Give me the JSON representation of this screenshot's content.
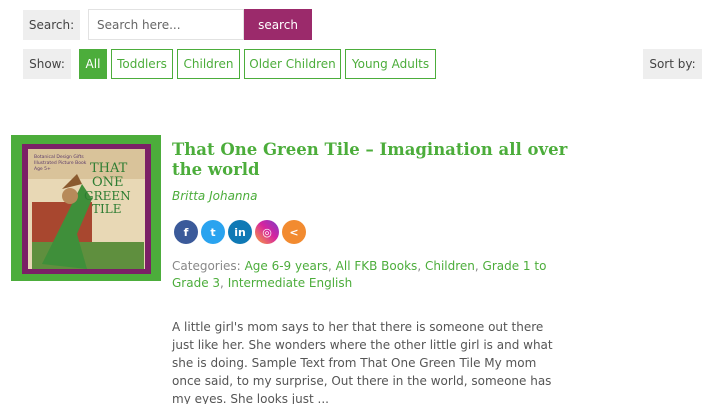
{
  "search": {
    "label": "Search:",
    "placeholder": "Search here...",
    "button_label": "search"
  },
  "filters": {
    "label": "Show:",
    "options": [
      "All",
      "Toddlers",
      "Children",
      "Older Children",
      "Young Adults"
    ],
    "active": "All"
  },
  "sort": {
    "label": "Sort by:"
  },
  "book": {
    "title": "That One Green Tile – Imagination all over the world",
    "author": "Britta Johanna",
    "cover": {
      "title_text": [
        "THAT",
        "ONE",
        "GREEN",
        "TILE"
      ],
      "small_text": [
        "Botanical Design Gifts",
        "Illustrated Picture Book",
        "Age 5+"
      ]
    },
    "share": [
      {
        "name": "facebook",
        "glyph": "f",
        "color": "#3b5a9a"
      },
      {
        "name": "twitter",
        "glyph": "t",
        "color": "#2aa3ef"
      },
      {
        "name": "linkedin",
        "glyph": "in",
        "color": "#0f79b5"
      },
      {
        "name": "instagram",
        "glyph": "◎",
        "color": "#d6249f"
      },
      {
        "name": "share",
        "glyph": "<",
        "color": "#f28b30"
      }
    ],
    "categories_label": "Categories:",
    "categories": [
      "Age 6-9 years",
      "All FKB Books",
      "Children",
      "Grade 1 to Grade 3",
      "Intermediate English"
    ],
    "excerpt": "A little girl's mom says to her that there is someone out there just like her. She wonders where the other little girl is and what she is doing. Sample Text from That One Green Tile My mom once said, to my surprise, Out there in the world, someone has my eyes. She looks just ..."
  },
  "colors": {
    "accent_green": "#4cad3b",
    "accent_purple": "#9b2a6b",
    "label_bg": "#eeeeee"
  }
}
